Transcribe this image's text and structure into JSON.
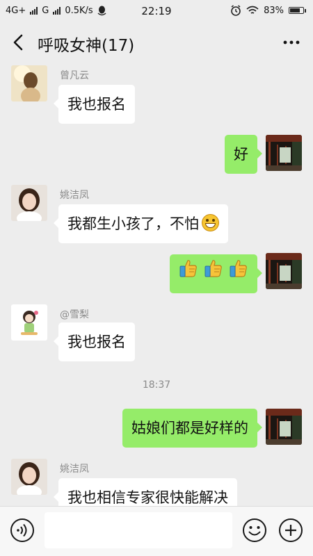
{
  "status_bar": {
    "network_left": "4G+",
    "network_mid": "G",
    "speed": "0.5K/s",
    "time": "22:19",
    "battery_text": "83%",
    "battery_level": 0.83
  },
  "nav": {
    "title": "呼吸女神(17)"
  },
  "messages": [
    {
      "sender": "曾凡云",
      "text": "我也报名",
      "direction": "in"
    },
    {
      "text": "好",
      "direction": "out"
    },
    {
      "sender": "姚洁凤",
      "text": "我都生小孩了，不怕",
      "emoji": "grin-icon",
      "direction": "in"
    },
    {
      "emojis": [
        "thumbs-up-icon",
        "thumbs-up-icon",
        "thumbs-up-icon"
      ],
      "direction": "out"
    },
    {
      "sender": "@雪梨",
      "text": "我也报名",
      "direction": "in"
    },
    {
      "time": "18:37"
    },
    {
      "text": "姑娘们都是好样的",
      "direction": "out"
    },
    {
      "sender": "姚洁凤",
      "text": "我也相信专家很快能解决",
      "direction": "in"
    }
  ],
  "input": {
    "value": ""
  },
  "colors": {
    "background": "#ededed",
    "bubble_out": "#95ec69",
    "bubble_in": "#ffffff"
  }
}
